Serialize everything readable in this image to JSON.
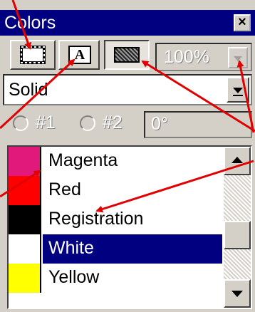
{
  "window": {
    "title": "Colors",
    "close_label": "×"
  },
  "toolbar": {
    "buttons": [
      {
        "name": "frame-color-button",
        "icon": "frame-icon",
        "pressed": false
      },
      {
        "name": "text-color-button",
        "icon": "text-a-icon",
        "glyph": "A",
        "pressed": false
      },
      {
        "name": "background-color-button",
        "icon": "background-icon",
        "pressed": true
      }
    ],
    "shade_value": "100%"
  },
  "blend": {
    "style_value": "Solid",
    "radio1_label": "#1",
    "radio2_label": "#2",
    "angle_value": "0°"
  },
  "color_list": {
    "items": [
      {
        "label": "Magenta",
        "color": "#e0197a",
        "selected": false
      },
      {
        "label": "Red",
        "color": "#ff0000",
        "selected": false
      },
      {
        "label": "Registration",
        "color": "#000000",
        "selected": false
      },
      {
        "label": "White",
        "color": "#ffffff",
        "selected": true
      },
      {
        "label": "Yellow",
        "color": "#ffff00",
        "selected": false
      }
    ]
  },
  "colors": {
    "titlebar": "#000080",
    "panel": "#d4d0c8",
    "selection": "#000080",
    "annotation_arrow": "#e00000"
  }
}
